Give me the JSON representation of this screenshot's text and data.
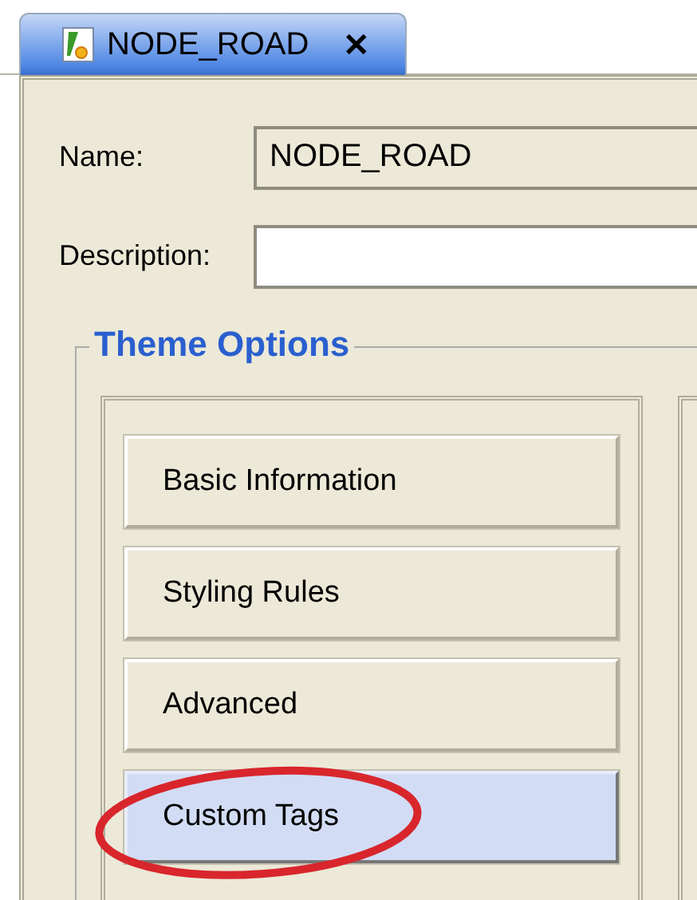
{
  "tab": {
    "title": "NODE_ROAD",
    "close": "✕",
    "selected": true
  },
  "fields": [
    {
      "label": "Name:",
      "value": "NODE_ROAD",
      "editable": false
    },
    {
      "label": "Description:",
      "editable": true
    }
  ],
  "theme_options": {
    "title": "Theme Options",
    "items": [
      {
        "label": "Basic Information",
        "selected": false
      },
      {
        "label": "Styling Rules",
        "selected": false
      },
      {
        "label": "Advanced",
        "selected": false
      },
      {
        "label": "Custom Tags",
        "selected": true
      }
    ]
  }
}
